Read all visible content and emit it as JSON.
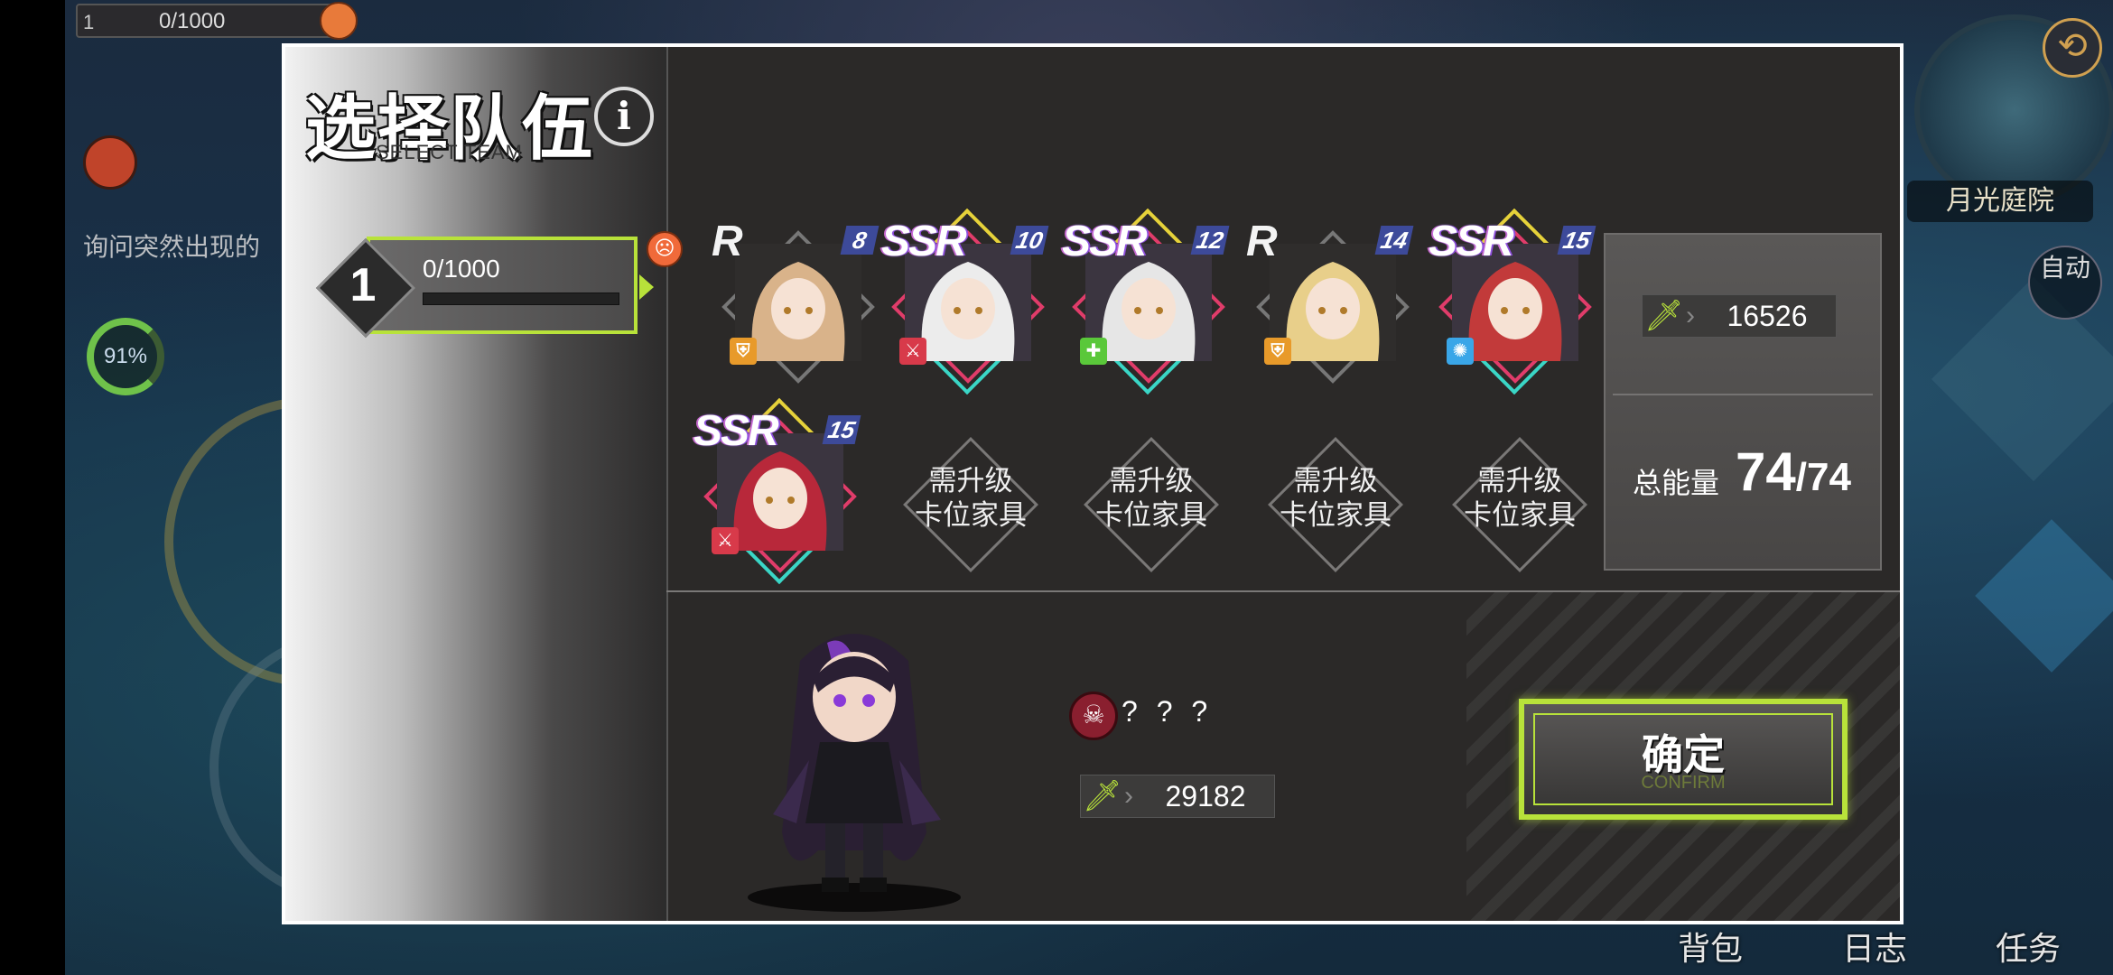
{
  "background": {
    "hp_level": "1",
    "hp_text": "0/1000",
    "quest_text": "询问突然出现的",
    "progress_percent": "91%",
    "location": "月光庭院",
    "auto_label": "自动",
    "bottom_nav": [
      "背包",
      "日志",
      "任务"
    ]
  },
  "modal": {
    "title": "选择队伍",
    "subtitle": "SELECT TEAM",
    "info_icon": "i",
    "team": {
      "number": "1",
      "hp_text": "0/1000",
      "hp_fraction": 0.0
    },
    "cards": [
      {
        "rarity": "R",
        "level": "8",
        "role": "shield-icon",
        "hair": "#d9b38a"
      },
      {
        "rarity": "SSR",
        "level": "10",
        "role": "dagger-icon",
        "hair": "#ececec"
      },
      {
        "rarity": "SSR",
        "level": "12",
        "role": "heal-icon",
        "hair": "#e6e6e6"
      },
      {
        "rarity": "R",
        "level": "14",
        "role": "shield-icon",
        "hair": "#e8cf8a"
      },
      {
        "rarity": "SSR",
        "level": "15",
        "role": "magic-icon",
        "hair": "#c23a3a"
      },
      {
        "rarity": "SSR",
        "level": "15",
        "role": "dagger-icon",
        "hair": "#b8283a"
      }
    ],
    "locked_slots": [
      {
        "line1": "需升级",
        "line2": "卡位家具"
      },
      {
        "line1": "需升级",
        "line2": "卡位家具"
      },
      {
        "line1": "需升级",
        "line2": "卡位家具"
      },
      {
        "line1": "需升级",
        "line2": "卡位家具"
      }
    ],
    "team_power": "16526",
    "energy_label": "总能量",
    "energy_current": "74",
    "energy_max": "/74",
    "enemy": {
      "name": "? ? ?",
      "power": "29182"
    },
    "confirm": {
      "label": "确定",
      "sub": "CONFIRM"
    }
  },
  "colors": {
    "accent": "#b8e23a",
    "ssr_frame": "#e03c6a",
    "top_gem": "#e6d23a",
    "bottom_gem": "#3ad6c6"
  }
}
